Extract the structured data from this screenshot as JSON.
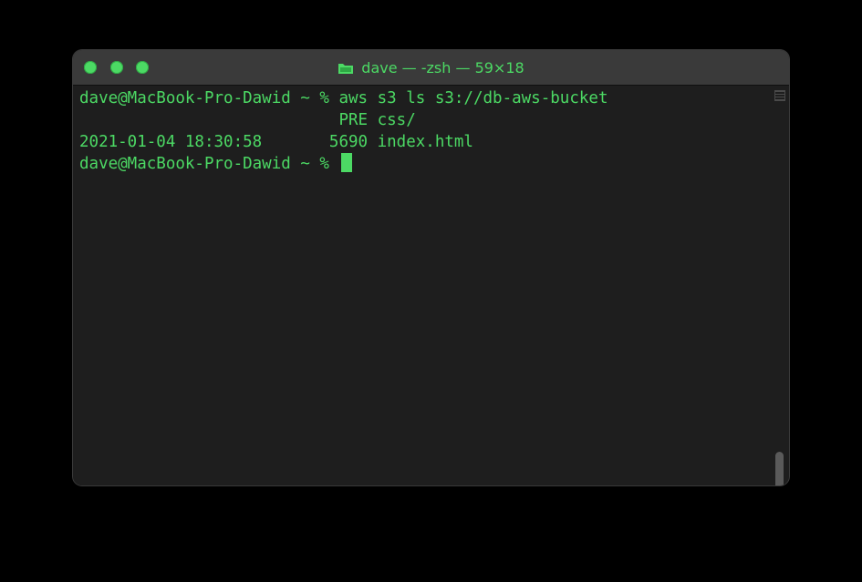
{
  "window": {
    "title": "dave — -zsh — 59×18",
    "title_icon": "folder-icon"
  },
  "terminal": {
    "lines": [
      "dave@MacBook-Pro-Dawid ~ % aws s3 ls s3://db-aws-bucket",
      "                           PRE css/",
      "2021-01-04 18:30:58       5690 index.html",
      "dave@MacBook-Pro-Dawid ~ % "
    ]
  },
  "colors": {
    "foreground": "#4cd964",
    "background": "#1e1e1e",
    "titlebar": "#3a3a3a"
  }
}
